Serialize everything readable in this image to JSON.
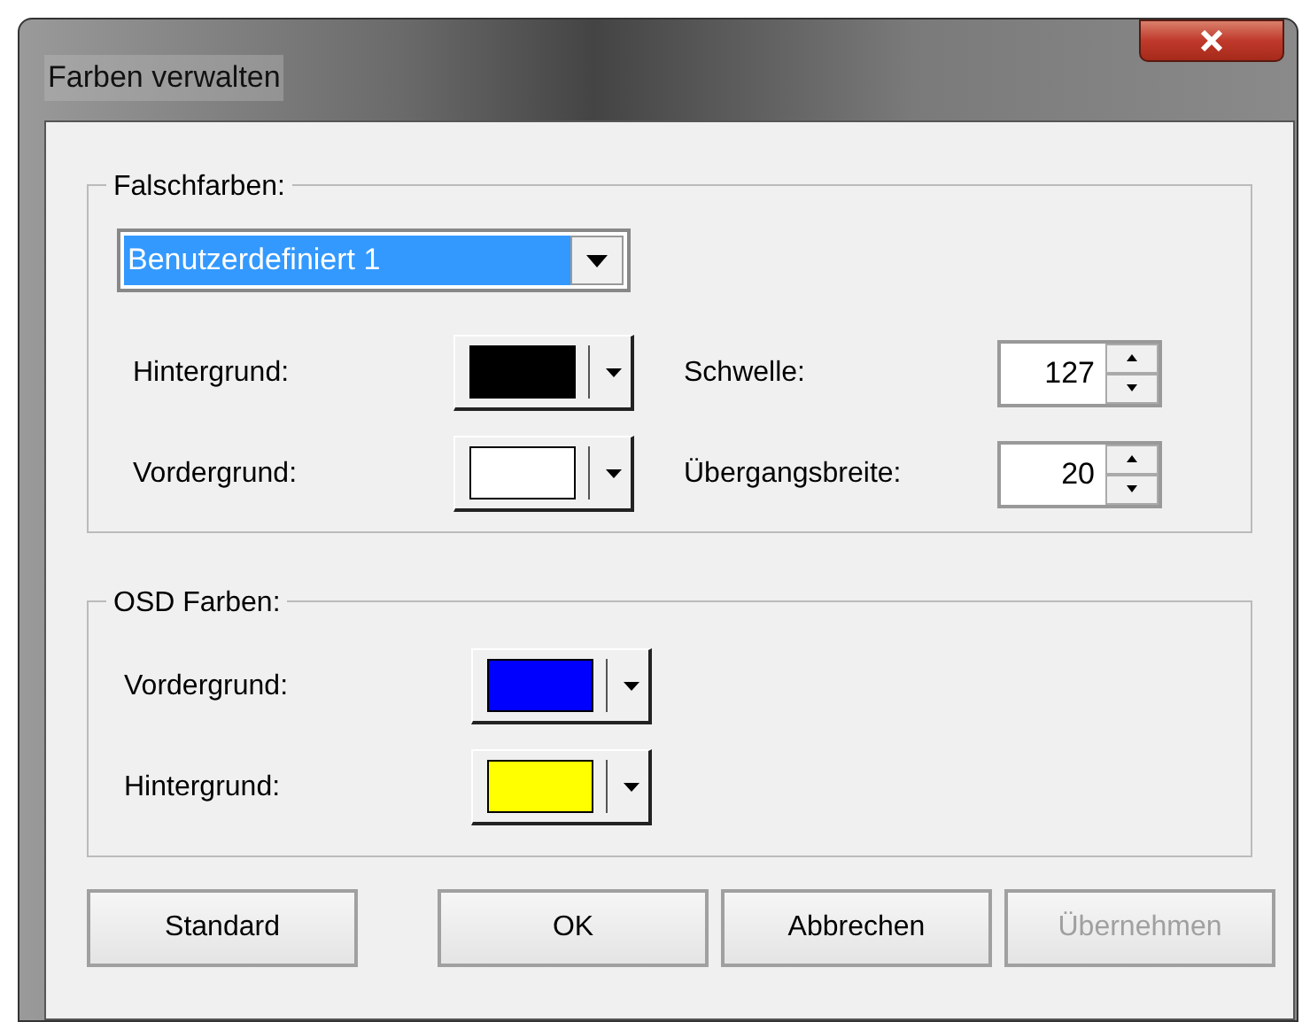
{
  "window": {
    "title": "Farben verwalten"
  },
  "false_colors": {
    "legend": "Falschfarben:",
    "preset": {
      "value": "Benutzerdefiniert 1"
    },
    "colors": [
      {
        "label": "Hintergrund:",
        "color": "#000000"
      },
      {
        "label": "Vordergrund:",
        "color": "#ffffff"
      }
    ],
    "spinners": [
      {
        "label": "Schwelle:",
        "value": "127"
      },
      {
        "label": "Übergangsbreite:",
        "value": "20"
      }
    ]
  },
  "osd_colors": {
    "legend": "OSD Farben:",
    "colors": [
      {
        "label": "Vordergrund:",
        "color": "#0000ff"
      },
      {
        "label": "Hintergrund:",
        "color": "#ffff00"
      }
    ]
  },
  "buttons": [
    {
      "label": "Standard",
      "disabled": false
    },
    {
      "label": "OK",
      "disabled": false
    },
    {
      "label": "Abbrechen",
      "disabled": false
    },
    {
      "label": "Übernehmen",
      "disabled": true
    }
  ]
}
